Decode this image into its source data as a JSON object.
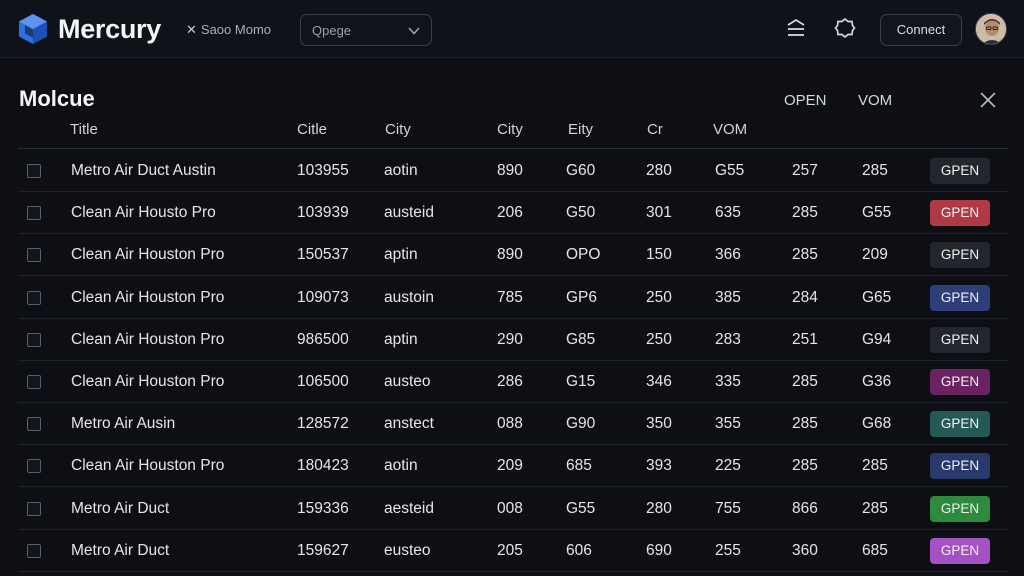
{
  "app": {
    "name": "Mercury",
    "status_text": "Saoo Momo",
    "select_value": "Qpege",
    "connect_label": "Connect"
  },
  "panel": {
    "title": "Molcue",
    "top_labels": [
      "OPEN",
      "VOM"
    ]
  },
  "table": {
    "headers": [
      "Title",
      "Citle",
      "City",
      "City",
      "Eity",
      "Cr",
      "VOM"
    ],
    "rows": [
      {
        "title": "Metro Air Duct Austin",
        "id": "103955",
        "city": "aotin",
        "c1": "890",
        "c2": "G60",
        "c3": "280",
        "c4": "G55",
        "c5": "257",
        "c6": "285",
        "status": "GPEN",
        "color": "#23262d"
      },
      {
        "title": "Clean Air Housto Pro",
        "id": "103939",
        "city": "austeid",
        "c1": "206",
        "c2": "G50",
        "c3": "301",
        "c4": "635",
        "c5": "285",
        "c6": "G55",
        "status": "GPEN",
        "color": "#b03a44"
      },
      {
        "title": "Clean Air Houston Pro",
        "id": "150537",
        "city": "aptin",
        "c1": "890",
        "c2": "OPO",
        "c3": "150",
        "c4": "366",
        "c5": "285",
        "c6": "209",
        "status": "GPEN",
        "color": "#23262d"
      },
      {
        "title": "Clean Air Houston Pro",
        "id": "109073",
        "city": "austoin",
        "c1": "785",
        "c2": "GP6",
        "c3": "250",
        "c4": "385",
        "c5": "284",
        "c6": "G65",
        "status": "GPEN",
        "color": "#2c3f78"
      },
      {
        "title": "Clean Air Houston Pro",
        "id": "986500",
        "city": "aptin",
        "c1": "290",
        "c2": "G85",
        "c3": "250",
        "c4": "283",
        "c5": "251",
        "c6": "G94",
        "status": "GPEN",
        "color": "#23262d"
      },
      {
        "title": "Clean Air Houston Pro",
        "id": "106500",
        "city": "austeo",
        "c1": "286",
        "c2": "G15",
        "c3": "346",
        "c4": "335",
        "c5": "285",
        "c6": "G36",
        "status": "GPEN",
        "color": "#6a2360"
      },
      {
        "title": "Metro Air Ausin",
        "id": "128572",
        "city": "anstect",
        "c1": "088",
        "c2": "G90",
        "c3": "350",
        "c4": "355",
        "c5": "285",
        "c6": "G68",
        "status": "GPEN",
        "color": "#245a55"
      },
      {
        "title": "Clean Air Houston Pro",
        "id": "180423",
        "city": "aotin",
        "c1": "209",
        "c2": "685",
        "c3": "393",
        "c4": "225",
        "c5": "285",
        "c6": "285",
        "status": "GPEN",
        "color": "#283a6c"
      },
      {
        "title": "Metro Air Duct",
        "id": "159336",
        "city": "aesteid",
        "c1": "008",
        "c2": "G55",
        "c3": "280",
        "c4": "755",
        "c5": "866",
        "c6": "285",
        "status": "GPEN",
        "color": "#2e8a3c"
      },
      {
        "title": "Metro Air Duct",
        "id": "159627",
        "city": "eusteo",
        "c1": "205",
        "c2": "606",
        "c3": "690",
        "c4": "255",
        "c5": "360",
        "c6": "685",
        "status": "GPEN",
        "color": "#a451c4"
      }
    ]
  },
  "colors": {
    "background": "#0d0f14",
    "topbar": "#0f1218",
    "logo_blue": "#2f6ee0"
  }
}
